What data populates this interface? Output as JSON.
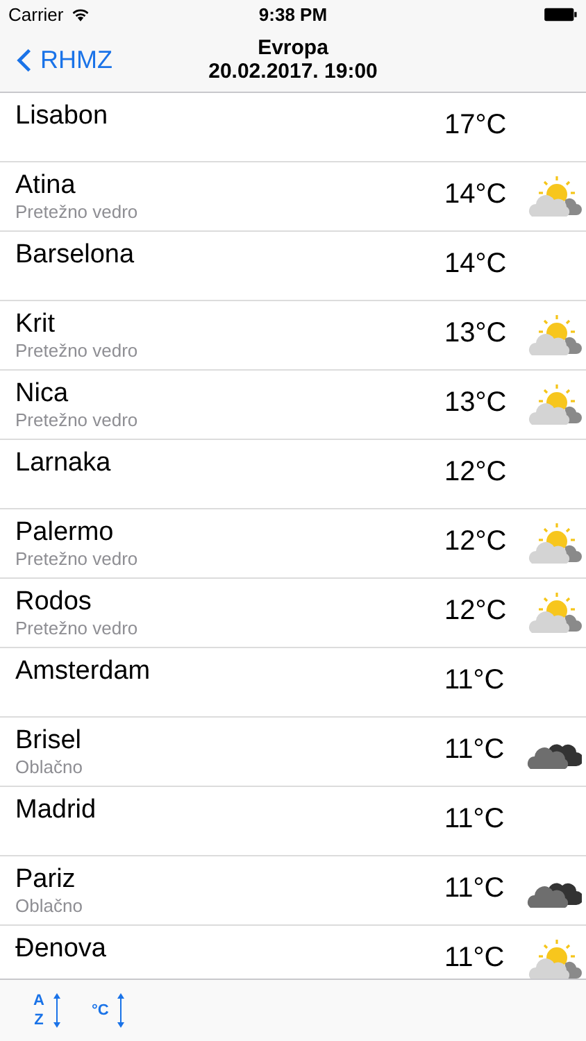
{
  "status_bar": {
    "carrier": "Carrier",
    "time": "9:38 PM"
  },
  "nav": {
    "back": "RHMZ",
    "title": "Evropa",
    "subtitle": "20.02.2017. 19:00"
  },
  "cities": [
    {
      "name": "Lisabon",
      "temp": "17°C"
    },
    {
      "name": "Atina",
      "condition": "Pretežno vedro",
      "temp": "14°C",
      "kind": "partly_sunny"
    },
    {
      "name": "Barselona",
      "temp": "14°C"
    },
    {
      "name": "Krit",
      "condition": "Pretežno vedro",
      "temp": "13°C",
      "kind": "partly_sunny"
    },
    {
      "name": "Nica",
      "condition": "Pretežno vedro",
      "temp": "13°C",
      "kind": "partly_sunny"
    },
    {
      "name": "Larnaka",
      "temp": "12°C"
    },
    {
      "name": "Palermo",
      "condition": "Pretežno vedro",
      "temp": "12°C",
      "kind": "partly_sunny"
    },
    {
      "name": "Rodos",
      "condition": "Pretežno vedro",
      "temp": "12°C",
      "kind": "partly_sunny"
    },
    {
      "name": "Amsterdam",
      "temp": "11°C"
    },
    {
      "name": "Brisel",
      "condition": "Oblačno",
      "temp": "11°C",
      "kind": "cloudy"
    },
    {
      "name": "Madrid",
      "temp": "11°C"
    },
    {
      "name": "Pariz",
      "condition": "Oblačno",
      "temp": "11°C",
      "kind": "cloudy"
    },
    {
      "name": "Đenova",
      "temp": "11°C",
      "kind": "partly_sunny"
    }
  ],
  "toolbar": [
    {
      "kind": "alpha",
      "top": "A",
      "bottom": "Z"
    },
    {
      "kind": "temp",
      "label": "°C"
    }
  ]
}
